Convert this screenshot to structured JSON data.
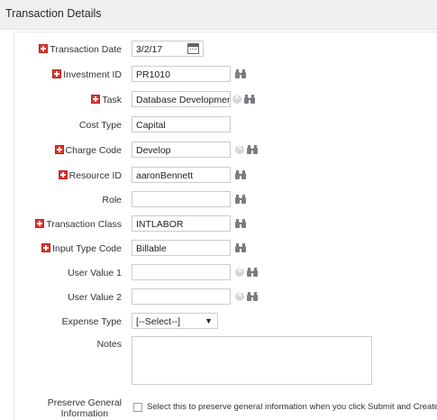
{
  "header": {
    "title": "Transaction Details"
  },
  "fields": {
    "transaction_date": {
      "label": "Transaction Date",
      "value": "3/2/17",
      "required": true
    },
    "investment_id": {
      "label": "Investment ID",
      "value": "PR1010",
      "required": true
    },
    "task": {
      "label": "Task",
      "value": "Database Developmen",
      "required": true
    },
    "cost_type": {
      "label": "Cost Type",
      "value": "Capital",
      "required": false
    },
    "charge_code": {
      "label": "Charge Code",
      "value": "Develop",
      "required": true
    },
    "resource_id": {
      "label": "Resource ID",
      "value": "aaronBennett",
      "required": true
    },
    "role": {
      "label": "Role",
      "value": "",
      "required": false
    },
    "transaction_class": {
      "label": "Transaction Class",
      "value": "INTLABOR",
      "required": true
    },
    "input_type_code": {
      "label": "Input Type Code",
      "value": "Billable",
      "required": true
    },
    "user_value_1": {
      "label": "User Value 1",
      "value": "",
      "required": false
    },
    "user_value_2": {
      "label": "User Value 2",
      "value": "",
      "required": false
    },
    "expense_type": {
      "label": "Expense Type",
      "selected": "[--Select--]",
      "arrow": "▼"
    },
    "notes": {
      "label": "Notes",
      "value": ""
    },
    "preserve": {
      "label_line1": "Preserve General",
      "label_line2": "Information",
      "checkbox_text": "Select this to preserve general information when you click Submit and Create Ne"
    }
  },
  "colors": {
    "required_marker": "#e0322d",
    "header_bg": "#eef0f2",
    "field_border": "#c9ccd0",
    "icon": "#7a7d82"
  }
}
